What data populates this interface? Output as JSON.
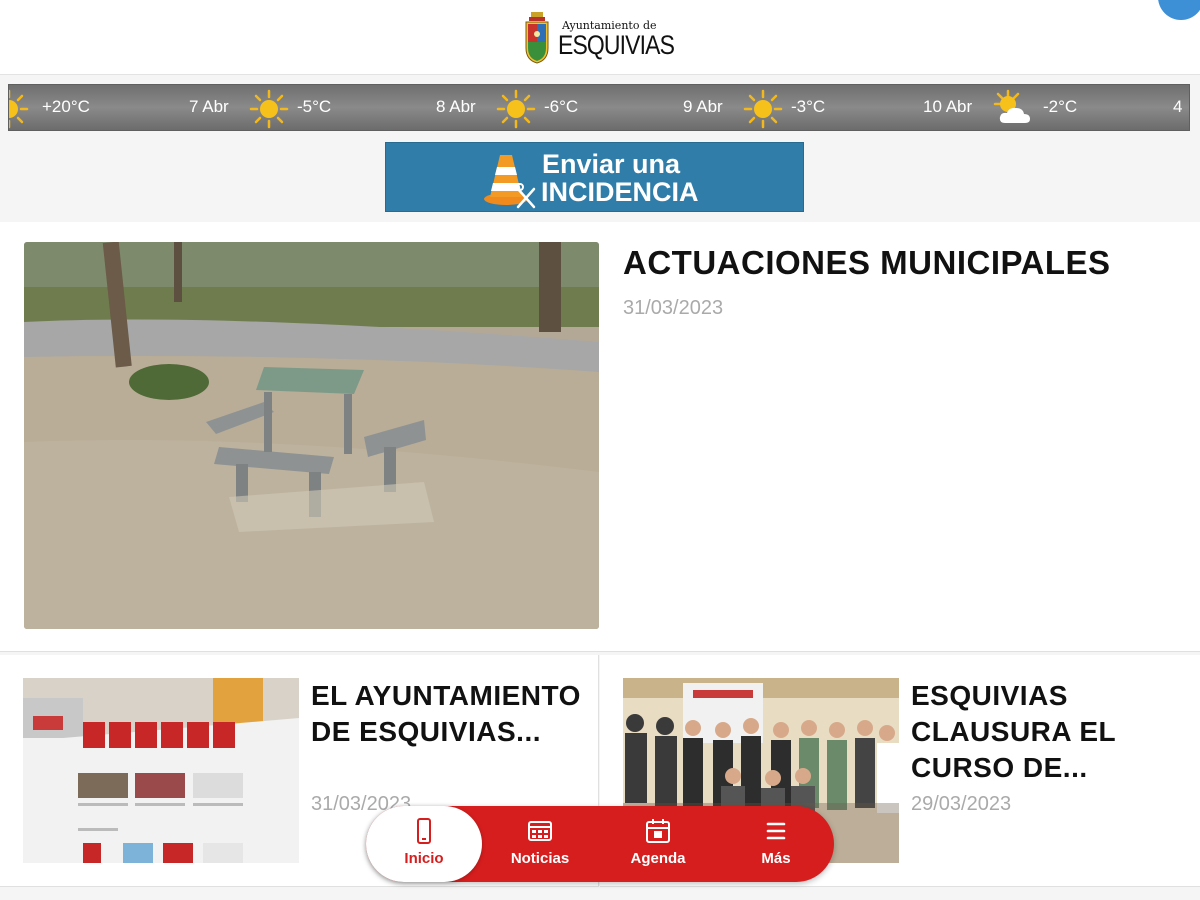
{
  "header": {
    "logo_small": "Ayuntamiento de",
    "logo_big": "ESQUIVIAS"
  },
  "weather": {
    "days": [
      {
        "date": "",
        "temp": "+20°C",
        "icon": "sun-icon"
      },
      {
        "date": "7 Abr",
        "temp": "-5°C",
        "icon": "sun-icon"
      },
      {
        "date": "8 Abr",
        "temp": "-6°C",
        "icon": "sun-icon"
      },
      {
        "date": "9 Abr",
        "temp": "-3°C",
        "icon": "sun-icon"
      },
      {
        "date": "10 Abr",
        "temp": "-2°C",
        "icon": "partly-cloudy-icon"
      },
      {
        "date": "4",
        "temp": "",
        "icon": ""
      }
    ]
  },
  "incidencia": {
    "line1": "Enviar una",
    "line2": "INCIDENCIA"
  },
  "featured": {
    "title": "ACTUACIONES MUNICIPALES",
    "date": "31/03/2023"
  },
  "articles": [
    {
      "title": "EL AYUNTAMIENTO DE ESQUIVIAS...",
      "date": "31/03/2023"
    },
    {
      "title": "ESQUIVIAS CLAUSURA EL CURSO DE...",
      "date": "29/03/2023"
    }
  ],
  "nav": {
    "items": [
      {
        "label": "Inicio",
        "icon": "phone-icon",
        "active": true
      },
      {
        "label": "Noticias",
        "icon": "newspaper-icon",
        "active": false
      },
      {
        "label": "Agenda",
        "icon": "calendar-icon",
        "active": false
      },
      {
        "label": "Más",
        "icon": "menu-icon",
        "active": false
      }
    ]
  },
  "colors": {
    "nav_red": "#d61e1e",
    "banner_blue": "#2f7da8",
    "weather_bar": "#7a7a7a"
  }
}
